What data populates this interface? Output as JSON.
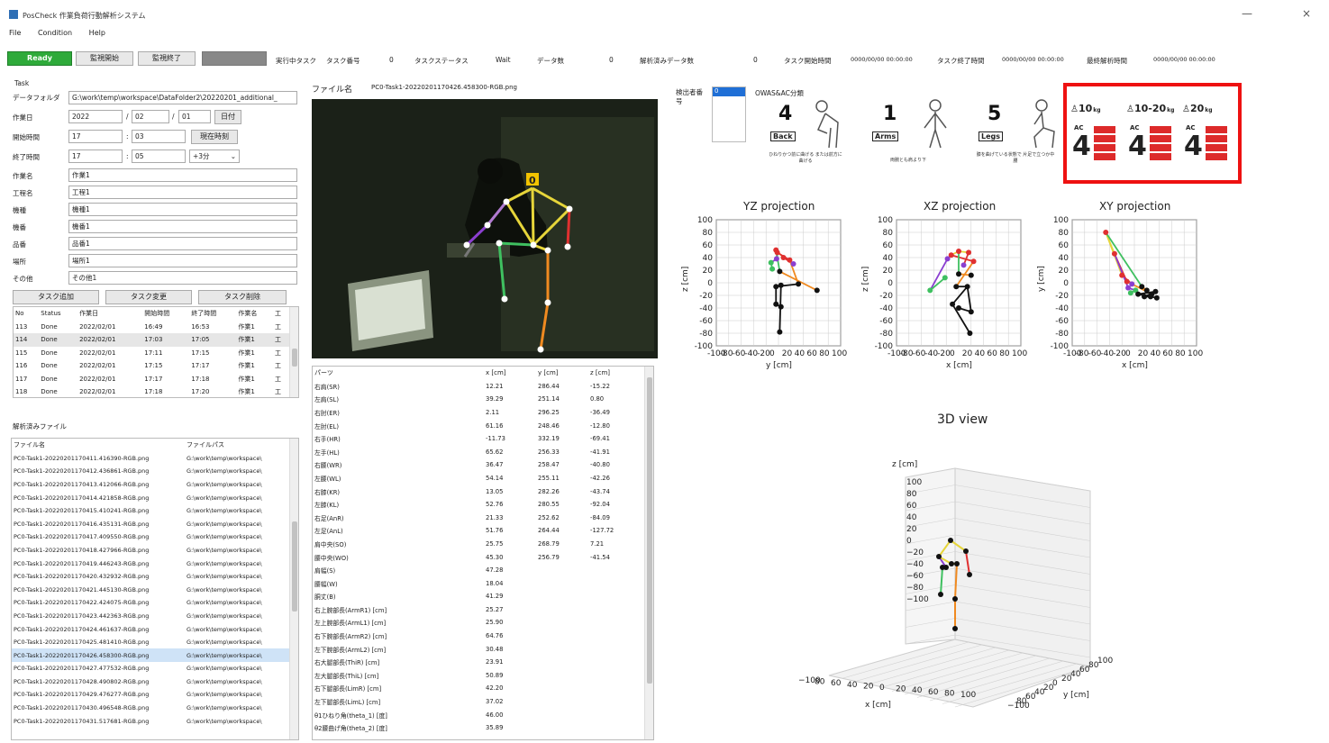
{
  "window": {
    "title": "PosCheck 作業負荷行動解析システム",
    "minimize": "—",
    "close": "×"
  },
  "menu": [
    "File",
    "Condition",
    "Help"
  ],
  "toolbar": {
    "ready": "Ready",
    "start": "監視開始",
    "stop": "監視終了",
    "running_task_label": "実行中タスク",
    "task_no_label": "タスク番号",
    "task_no_value": "0",
    "task_status_label": "タスクステータス",
    "task_status_value": "Wait",
    "data_count_label": "データ数",
    "data_count_value": "0",
    "analyzed_count_label": "解析済みデータ数",
    "analyzed_count_value": "0",
    "task_start_label": "タスク開始時間",
    "task_start_value": "0000/00/00 00:00:00",
    "task_end_label": "タスク終了時間",
    "task_end_value": "0000/00/00 00:00:00",
    "final_label": "最終解析時間",
    "final_value": "0000/00/00 00:00:00"
  },
  "task": {
    "section": "Task",
    "folder_label": "データフォルダ",
    "folder_value": "G:\\work\\temp\\workspace\\DataFolder2\\20220201_additional_",
    "date_label": "作業日",
    "year": "2022",
    "month": "02",
    "day": "01",
    "date_btn": "日付",
    "start_label": "開始時間",
    "start_h": "17",
    "start_m": "03",
    "now_btn": "現在時刻",
    "end_label": "終了時間",
    "end_h": "17",
    "end_m": "05",
    "plus_btn": "+3分",
    "fields": [
      {
        "label": "作業名",
        "value": "作業1"
      },
      {
        "label": "工程名",
        "value": "工程1"
      },
      {
        "label": "機種",
        "value": "機種1"
      },
      {
        "label": "機番",
        "value": "機番1"
      },
      {
        "label": "品番",
        "value": "品番1"
      },
      {
        "label": "場所",
        "value": "場所1"
      },
      {
        "label": "その他",
        "value": "その他1"
      }
    ],
    "add_btn": "タスク追加",
    "change_btn": "タスク変更",
    "delete_btn": "タスク削除"
  },
  "task_table": {
    "headers": [
      "No",
      "Status",
      "作業日",
      "開始時間",
      "終了時間",
      "作業名",
      "工"
    ],
    "rows": [
      [
        "113",
        "Done",
        "2022/02/01",
        "16:49",
        "16:53",
        "作業1",
        "工"
      ],
      [
        "114",
        "Done",
        "2022/02/01",
        "17:03",
        "17:05",
        "作業1",
        "工"
      ],
      [
        "115",
        "Done",
        "2022/02/01",
        "17:11",
        "17:15",
        "作業1",
        "工"
      ],
      [
        "116",
        "Done",
        "2022/02/01",
        "17:15",
        "17:17",
        "作業1",
        "工"
      ],
      [
        "117",
        "Done",
        "2022/02/01",
        "17:17",
        "17:18",
        "作業1",
        "工"
      ],
      [
        "118",
        "Done",
        "2022/02/01",
        "17:18",
        "17:20",
        "作業1",
        "工"
      ]
    ]
  },
  "files": {
    "section": "解析済みファイル",
    "headers": [
      "ファイル名",
      "ファイルパス"
    ],
    "rows": [
      "PC0-Task1-20220201170411.416390-RGB.png",
      "PC0-Task1-20220201170412.436861-RGB.png",
      "PC0-Task1-20220201170413.412066-RGB.png",
      "PC0-Task1-20220201170414.421858-RGB.png",
      "PC0-Task1-20220201170415.410241-RGB.png",
      "PC0-Task1-20220201170416.435131-RGB.png",
      "PC0-Task1-20220201170417.409550-RGB.png",
      "PC0-Task1-20220201170418.427966-RGB.png",
      "PC0-Task1-20220201170419.446243-RGB.png",
      "PC0-Task1-20220201170420.432932-RGB.png",
      "PC0-Task1-20220201170421.445130-RGB.png",
      "PC0-Task1-20220201170422.424075-RGB.png",
      "PC0-Task1-20220201170423.442363-RGB.png",
      "PC0-Task1-20220201170424.461637-RGB.png",
      "PC0-Task1-20220201170425.481410-RGB.png",
      "PC0-Task1-20220201170426.458300-RGB.png",
      "PC0-Task1-20220201170427.477532-RGB.png",
      "PC0-Task1-20220201170428.490802-RGB.png",
      "PC0-Task1-20220201170429.476277-RGB.png",
      "PC0-Task1-20220201170430.496548-RGB.png",
      "PC0-Task1-20220201170431.517681-RGB.png"
    ],
    "path": "G:\\work\\temp\\workspace\\",
    "selected_index": 15
  },
  "viewer": {
    "filename_label": "ファイル名",
    "filename": "PC0-Task1-20220201170426.458300-RGB.png",
    "person_id": "0"
  },
  "joints_table": {
    "headers": [
      "パーツ",
      "x [cm]",
      "y [cm]",
      "z [cm]"
    ],
    "rows": [
      [
        "右肩(SR)",
        "12.21",
        "286.44",
        "-15.22"
      ],
      [
        "左肩(SL)",
        "39.29",
        "251.14",
        "0.80"
      ],
      [
        "右肘(ER)",
        "2.11",
        "296.25",
        "-36.49"
      ],
      [
        "左肘(EL)",
        "61.16",
        "248.46",
        "-12.80"
      ],
      [
        "右手(HR)",
        "-11.73",
        "332.19",
        "-69.41"
      ],
      [
        "左手(HL)",
        "65.62",
        "256.33",
        "-41.91"
      ],
      [
        "右腰(WR)",
        "36.47",
        "258.47",
        "-40.80"
      ],
      [
        "左腰(WL)",
        "54.14",
        "255.11",
        "-42.26"
      ],
      [
        "右膝(KR)",
        "13.05",
        "282.26",
        "-43.74"
      ],
      [
        "左膝(KL)",
        "52.76",
        "280.55",
        "-92.04"
      ],
      [
        "右足(AnR)",
        "21.33",
        "252.62",
        "-84.09"
      ],
      [
        "左足(AnL)",
        "51.76",
        "264.44",
        "-127.72"
      ],
      [
        "肩中央(SO)",
        "25.75",
        "268.79",
        "7.21"
      ],
      [
        "腰中央(WO)",
        "45.30",
        "256.79",
        "-41.54"
      ],
      [
        "肩幅(S)",
        "47.28",
        "",
        ""
      ],
      [
        "腰幅(W)",
        "18.04",
        "",
        ""
      ],
      [
        "胴丈(B)",
        "41.29",
        "",
        ""
      ],
      [
        "右上腕部長(ArmR1) [cm]",
        "25.27",
        "",
        ""
      ],
      [
        "左上腕部長(ArmL1) [cm]",
        "25.90",
        "",
        ""
      ],
      [
        "右下腕部長(ArmR2) [cm]",
        "64.76",
        "",
        ""
      ],
      [
        "左下腕部長(ArmL2) [cm]",
        "30.48",
        "",
        ""
      ],
      [
        "右大腿部長(ThiR) [cm]",
        "23.91",
        "",
        ""
      ],
      [
        "左大腿部長(ThiL) [cm]",
        "50.89",
        "",
        ""
      ],
      [
        "右下腿部長(LimR) [cm]",
        "42.20",
        "",
        ""
      ],
      [
        "左下腿部長(LimL) [cm]",
        "37.02",
        "",
        ""
      ],
      [
        "θ1ひねり角(theta_1) [度]",
        "46.00",
        "",
        ""
      ],
      [
        "θ2腰曲げ角(theta_2) [度]",
        "35.89",
        "",
        ""
      ]
    ]
  },
  "detector": {
    "label": "検出者番号",
    "value": "0"
  },
  "owas": {
    "title": "OWAS&AC分類",
    "back": {
      "value": "4",
      "tag": "Back",
      "caption": "ひねりかつ前に曲げる または前方に曲げる"
    },
    "arms": {
      "value": "1",
      "tag": "Arms",
      "caption": "両腕とも肩より下"
    },
    "legs": {
      "value": "5",
      "tag": "Legs",
      "caption": "膝を曲げている状態で 片足で立つか中腰"
    }
  },
  "ac": {
    "items": [
      {
        "weight": "10",
        "unit": "kg",
        "ac_label": "AC",
        "value": "4"
      },
      {
        "weight": "10-20",
        "unit": "kg",
        "ac_label": "AC",
        "value": "4"
      },
      {
        "weight": "20",
        "unit": "kg",
        "ac_label": "AC",
        "value": "4"
      }
    ]
  },
  "view3d": {
    "title": "3D view",
    "zlabel": "z [cm]",
    "xlabel": "x [cm]",
    "ylabel": "y [cm]",
    "zticks": [
      "100",
      "80",
      "60",
      "40",
      "20",
      "0",
      "−20",
      "−40",
      "−60",
      "−80",
      "−100"
    ],
    "xticks": [
      "−100",
      "80",
      "60",
      "40",
      "20",
      "0",
      "20",
      "40",
      "60",
      "80",
      "100"
    ],
    "yticks": [
      "−100",
      "80",
      "60",
      "40",
      "20",
      "0",
      "20",
      "40",
      "60",
      "80",
      "100"
    ]
  },
  "colors": {
    "ready": "#2eaa3a",
    "ac_border": "#ee1111",
    "ac_bar": "#dd2a2a",
    "selection": "#cfe3f7"
  },
  "chart_data": [
    {
      "type": "scatter",
      "title": "YZ projection",
      "xlabel": "y [cm]",
      "ylabel": "z [cm]",
      "xlim": [
        -100,
        100
      ],
      "ylim": [
        -100,
        100
      ],
      "xticks": [
        -100,
        -80,
        -60,
        -40,
        -20,
        0,
        20,
        40,
        60,
        80,
        100
      ],
      "yticks": [
        -100,
        -80,
        -60,
        -40,
        -20,
        0,
        20,
        40,
        60,
        80,
        100
      ],
      "grid": true,
      "points": [
        [
          -4,
          52
        ],
        [
          -2,
          48
        ],
        [
          8,
          40
        ],
        [
          18,
          36
        ],
        [
          24,
          30
        ],
        [
          -3,
          38
        ],
        [
          -12,
          32
        ],
        [
          -10,
          22
        ],
        [
          2,
          18
        ],
        [
          62,
          -12
        ],
        [
          32,
          -2
        ],
        [
          -4,
          -6
        ],
        [
          4,
          -4
        ],
        [
          -4,
          -34
        ],
        [
          4,
          -38
        ],
        [
          2,
          -78
        ]
      ]
    },
    {
      "type": "scatter",
      "title": "XZ projection",
      "xlabel": "x [cm]",
      "ylabel": "z [cm]",
      "xlim": [
        -100,
        100
      ],
      "ylim": [
        -100,
        100
      ],
      "xticks": [
        -100,
        -80,
        -60,
        -40,
        -20,
        0,
        20,
        40,
        60,
        80,
        100
      ],
      "yticks": [
        -100,
        -80,
        -60,
        -40,
        -20,
        0,
        20,
        40,
        60,
        80,
        100
      ],
      "grid": true,
      "points": [
        [
          0,
          50
        ],
        [
          -12,
          44
        ],
        [
          16,
          48
        ],
        [
          24,
          34
        ],
        [
          8,
          28
        ],
        [
          -18,
          38
        ],
        [
          -46,
          -12
        ],
        [
          -22,
          8
        ],
        [
          0,
          14
        ],
        [
          20,
          12
        ],
        [
          -4,
          -6
        ],
        [
          14,
          -6
        ],
        [
          -10,
          -34
        ],
        [
          20,
          -46
        ],
        [
          0,
          -40
        ],
        [
          18,
          -80
        ]
      ]
    },
    {
      "type": "scatter",
      "title": "XY projection",
      "xlabel": "x [cm]",
      "ylabel": "y [cm]",
      "xlim": [
        -100,
        100
      ],
      "ylim": [
        -100,
        100
      ],
      "xticks": [
        -100,
        -80,
        -60,
        -40,
        -20,
        0,
        20,
        40,
        60,
        80,
        100
      ],
      "yticks": [
        -100,
        -80,
        -60,
        -40,
        -20,
        0,
        20,
        40,
        60,
        80,
        100
      ],
      "grid": true,
      "points": [
        [
          -46,
          80
        ],
        [
          -32,
          46
        ],
        [
          -20,
          12
        ],
        [
          -12,
          2
        ],
        [
          -4,
          -2
        ],
        [
          -10,
          -8
        ],
        [
          2,
          -12
        ],
        [
          -6,
          -16
        ],
        [
          12,
          -6
        ],
        [
          20,
          -12
        ],
        [
          28,
          -18
        ],
        [
          34,
          -14
        ],
        [
          6,
          -18
        ],
        [
          16,
          -22
        ],
        [
          26,
          -22
        ],
        [
          36,
          -24
        ]
      ]
    }
  ]
}
